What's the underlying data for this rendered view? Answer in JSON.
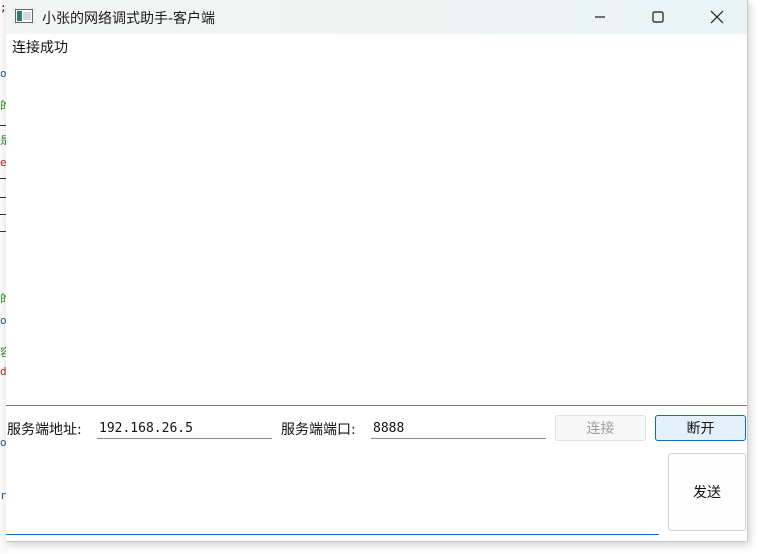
{
  "window": {
    "title": "小张的网络调式助手-客户端",
    "minimize_icon": "minimize-icon",
    "maximize_icon": "maximize-icon",
    "close_icon": "close-icon"
  },
  "receive": {
    "text": "连接成功"
  },
  "controls": {
    "server_address_label": "服务端地址:",
    "server_address_value": "192.168.26.5",
    "server_port_label": "服务端端口:",
    "server_port_value": "8888",
    "connect_label": "连接",
    "disconnect_label": "断开",
    "send_label": "发送"
  },
  "send": {
    "text": ""
  },
  "background_editor": {
    "fragments": [
      ";",
      "o",
      "的",
      "是",
      "e",
      "的",
      "o",
      "容",
      "d",
      "o",
      "r"
    ],
    "colors": {
      "blue": "#1f5f8b",
      "green": "#2e8b2e",
      "red": "#b22222",
      "dark": "#222222"
    }
  },
  "colors": {
    "accent": "#0f6cbd",
    "disabled_text": "#9e9e9e"
  }
}
